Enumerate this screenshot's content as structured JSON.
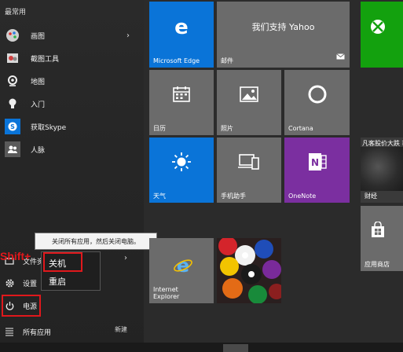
{
  "left_pane": {
    "section_header": "最常用",
    "apps": [
      {
        "label": "画图",
        "icon": "paint-icon",
        "has_submenu": true
      },
      {
        "label": "截图工具",
        "icon": "snipping-tool-icon",
        "has_submenu": false
      },
      {
        "label": "地图",
        "icon": "maps-icon",
        "has_submenu": false
      },
      {
        "label": "入门",
        "icon": "get-started-icon",
        "has_submenu": false
      },
      {
        "label": "获取Skype",
        "icon": "skype-icon",
        "has_submenu": false
      },
      {
        "label": "人脉",
        "icon": "people-icon",
        "has_submenu": false
      }
    ],
    "bottom": {
      "file_explorer": "文件资",
      "settings": "设置",
      "power": "电源",
      "all_apps": "所有应用",
      "new": "新建"
    },
    "annotation_text": "Shift+"
  },
  "tooltip": "关闭所有应用，然后关闭电脑。",
  "power_menu": {
    "shutdown": "关机",
    "restart": "重启"
  },
  "tiles": {
    "edge": {
      "label": "Microsoft Edge",
      "color": "#0a74d8"
    },
    "mail": {
      "label": "邮件",
      "headline": "我们支持 Yahoo",
      "color": "#6b6b6b"
    },
    "xbox": {
      "color": "#13a10e"
    },
    "calendar": {
      "label": "日历",
      "color": "#6b6b6b"
    },
    "photos": {
      "label": "照片",
      "color": "#6b6b6b"
    },
    "cortana": {
      "label": "Cortana",
      "color": "#6b6b6b"
    },
    "weather": {
      "label": "天气",
      "color": "#0a74d8"
    },
    "phone": {
      "label": "手机助手",
      "color": "#6b6b6b"
    },
    "onenote": {
      "label": "OneNote",
      "color": "#7b2fa0"
    },
    "finance": {
      "label": "财经",
      "headline": "凡客股价大跌 市",
      "color": "#3a3a3a"
    },
    "ie": {
      "label": "Internet Explorer",
      "color": "#6b6b6b"
    },
    "store": {
      "label": "应用商店",
      "color": "#6b6b6b"
    }
  }
}
